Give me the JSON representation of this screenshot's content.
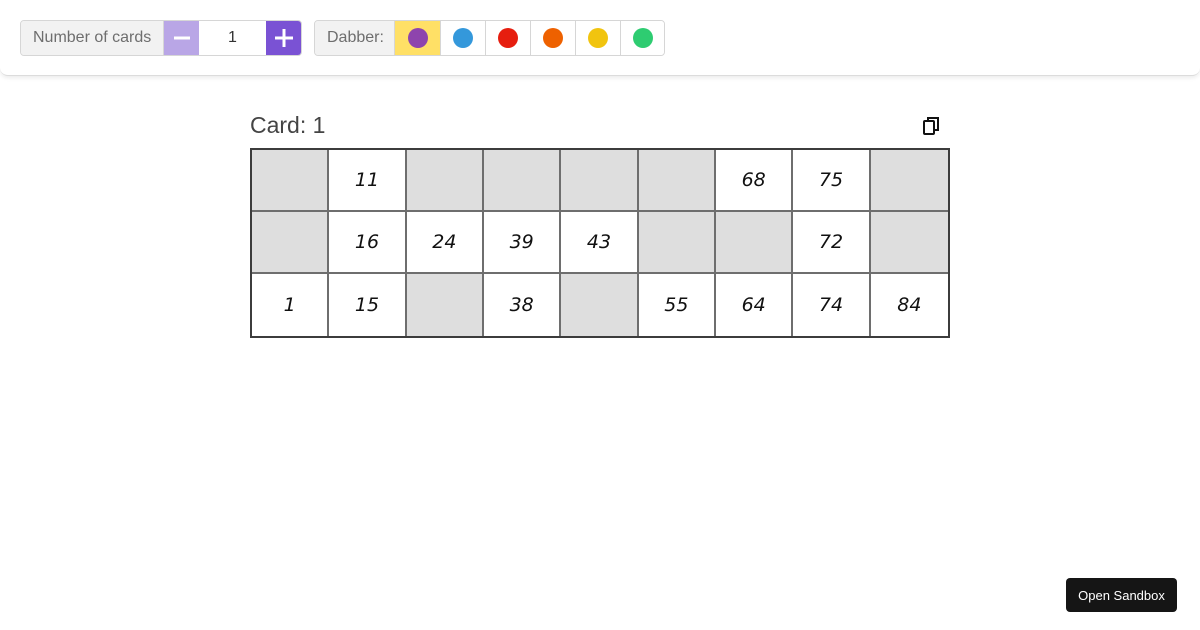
{
  "toolbar": {
    "count_label": "Number of cards",
    "count_value": "1",
    "dabber_label": "Dabber:",
    "dabber_colors": [
      {
        "name": "purple",
        "hex": "#8e44ad",
        "selected": true
      },
      {
        "name": "blue",
        "hex": "#3498db",
        "selected": false
      },
      {
        "name": "red",
        "hex": "#e61e0f",
        "selected": false
      },
      {
        "name": "orange",
        "hex": "#ee6100",
        "selected": false
      },
      {
        "name": "yellow",
        "hex": "#f1c40f",
        "selected": false
      },
      {
        "name": "green",
        "hex": "#2ecc71",
        "selected": false
      }
    ],
    "selected_highlight": "#ffe066",
    "minus_color": "#b9a6e6",
    "plus_color": "#7a52d4"
  },
  "card": {
    "title": "Card: 1",
    "rows": [
      [
        "",
        "11",
        "",
        "",
        "",
        "",
        "68",
        "75",
        ""
      ],
      [
        "",
        "16",
        "24",
        "39",
        "43",
        "",
        "",
        "72",
        ""
      ],
      [
        "1",
        "15",
        "",
        "38",
        "",
        "55",
        "64",
        "74",
        "84"
      ]
    ]
  },
  "footer": {
    "sandbox_label": "Open Sandbox"
  }
}
